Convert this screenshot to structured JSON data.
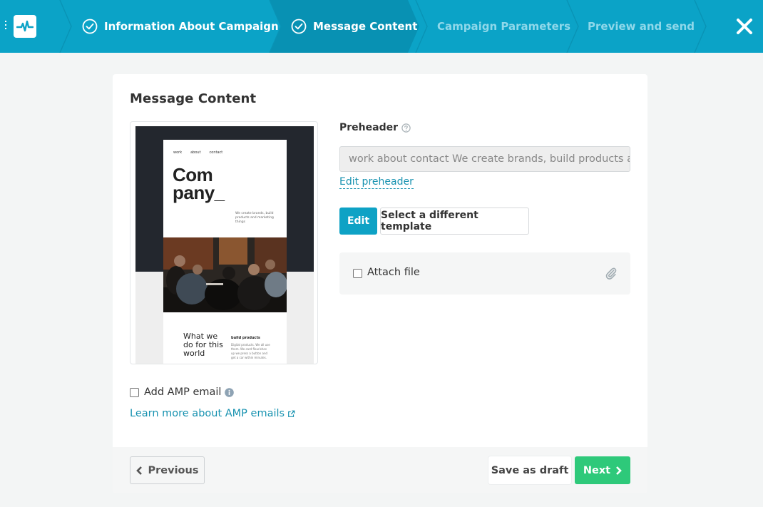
{
  "wizard": {
    "steps": [
      {
        "label": "Information About Campaign",
        "state": "done"
      },
      {
        "label": "Message Content",
        "state": "current"
      },
      {
        "label": "Campaign Parameters",
        "state": "pending"
      },
      {
        "label": "Preview and send",
        "state": "pending"
      }
    ],
    "icons": {
      "logo": "pulse-logo-icon",
      "close": "close-icon",
      "check": "check-circle-icon"
    },
    "colors": {
      "bar": "#0ba3c7",
      "current_step": "#0891b3",
      "pending_text": "#8fd8ea"
    }
  },
  "card": {
    "title": "Message Content"
  },
  "template_preview": {
    "nav": [
      "work",
      "about",
      "contact"
    ],
    "logo_line1": "Com",
    "logo_line2": "pany_",
    "tagline": "We create brands, build products and marketing things",
    "section_title": "What we do for this world",
    "build_heading": "build products",
    "build_text": "Digital products. We all use them. We card flourishes up we press a button and get a car within minutes."
  },
  "preheader": {
    "label": "Preheader",
    "value": "work about contact We create brands, build products and marketing things",
    "edit_link": "Edit preheader",
    "help_icon": "question-circle-icon"
  },
  "actions": {
    "edit_label": "Edit",
    "select_template_label": "Select a different template"
  },
  "attach": {
    "label": "Attach file",
    "checked": false,
    "icon": "paperclip-icon"
  },
  "amp": {
    "label": "Add AMP email",
    "checked": false,
    "info_icon": "info-circle-icon",
    "learn_more": "Learn more about AMP emails",
    "external_icon": "external-link-icon"
  },
  "footer": {
    "previous_label": "Previous",
    "draft_label": "Save as draft",
    "next_label": "Next",
    "colors": {
      "next": "#2ec97a",
      "link": "#1792b0"
    }
  }
}
